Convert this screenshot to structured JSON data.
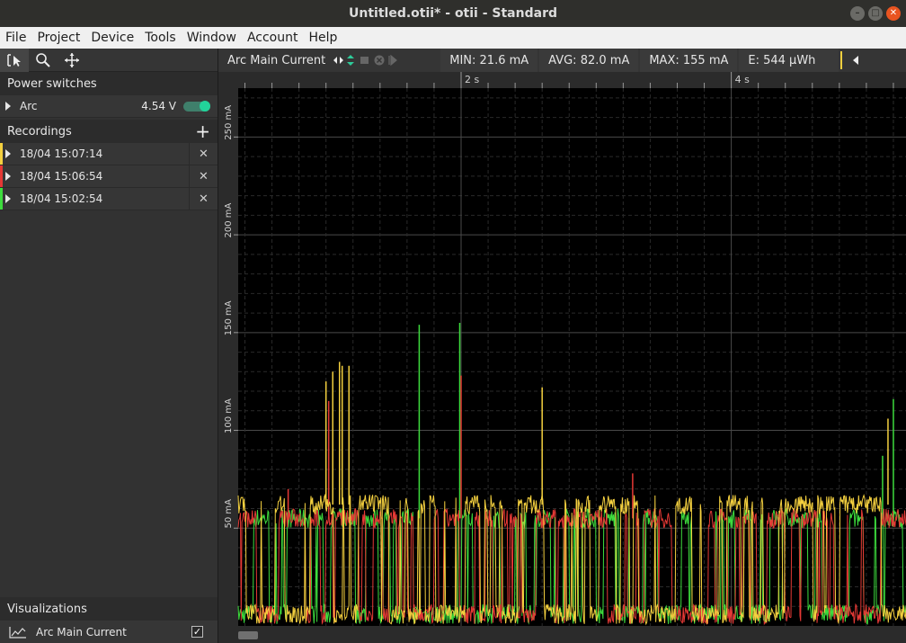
{
  "window": {
    "title": "Untitled.otii* - otii - Standard"
  },
  "menu": [
    "File",
    "Project",
    "Device",
    "Tools",
    "Window",
    "Account",
    "Help"
  ],
  "toolbar": {
    "tools": [
      "select-tool-icon",
      "zoom-icon",
      "pan-icon"
    ]
  },
  "power_switches": {
    "header": "Power switches",
    "device": "Arc",
    "voltage": "4.54 V",
    "enabled": true
  },
  "recordings": {
    "header": "Recordings",
    "items": [
      {
        "label": "18/04 15:07:14",
        "color": "#f4d03f"
      },
      {
        "label": "18/04 15:06:54",
        "color": "#e53935"
      },
      {
        "label": "18/04 15:02:54",
        "color": "#3ddc3d"
      }
    ]
  },
  "visualizations": {
    "header": "Visualizations",
    "items": [
      {
        "label": "Arc Main Current",
        "checked": true
      }
    ]
  },
  "graph": {
    "channel": "Arc Main Current",
    "min": "MIN: 21.6 mA",
    "avg": "AVG: 82.0 mA",
    "max": "MAX: 155 mA",
    "energy": "E: 544 µWh"
  },
  "chart_data": {
    "type": "line",
    "x_ticks": [
      "2 s",
      "4 s"
    ],
    "y_ticks": [
      "50 mA",
      "100 mA",
      "150 mA",
      "200 mA",
      "250 mA"
    ],
    "x_unit": "s",
    "y_unit": "mA",
    "xlim": [
      0.35,
      5.3
    ],
    "ylim": [
      0,
      275
    ],
    "grid": true,
    "series": [
      {
        "color": "#f4d03f",
        "baseline_low": 6,
        "baseline_high": 62,
        "spikes": [
          [
            1.0,
            125
          ],
          [
            1.05,
            130
          ],
          [
            1.1,
            135
          ],
          [
            1.12,
            133
          ],
          [
            1.17,
            133
          ],
          [
            2.6,
            122
          ],
          [
            5.16,
            106
          ]
        ]
      },
      {
        "color": "#e53935",
        "baseline_low": 6,
        "baseline_high": 55,
        "spikes": [
          [
            0.72,
            70
          ],
          [
            1.02,
            115
          ],
          [
            2.0,
            128
          ],
          [
            3.27,
            78
          ]
        ]
      },
      {
        "color": "#3ddc3d",
        "baseline_low": 6,
        "baseline_high": 55,
        "spikes": [
          [
            1.69,
            154
          ],
          [
            1.99,
            155
          ],
          [
            5.2,
            116
          ],
          [
            5.12,
            87
          ]
        ]
      }
    ]
  }
}
